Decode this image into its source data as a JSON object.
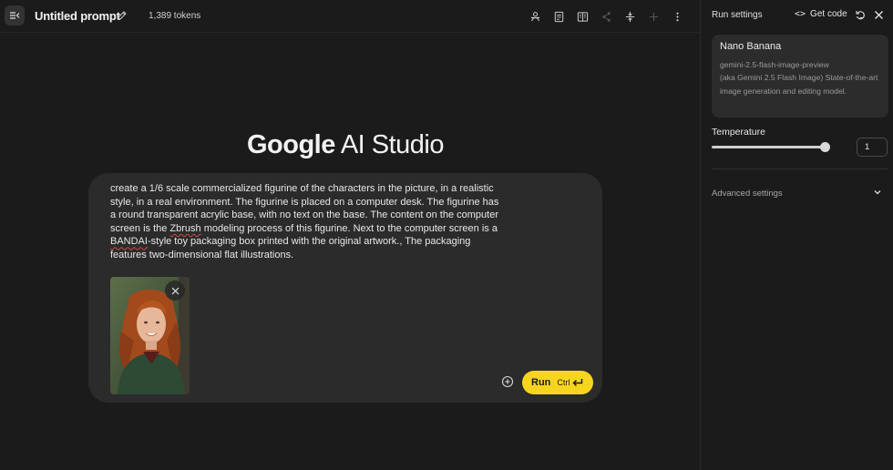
{
  "header": {
    "title": "Untitled prompt",
    "tokens": "1,389 tokens",
    "icons": [
      "menu-collapse-icon",
      "edit-icon",
      "compare-icon",
      "document-icon",
      "book-icon",
      "share-icon",
      "compress-icon",
      "add-icon",
      "more-vert-icon"
    ]
  },
  "main": {
    "brand_google": "Google",
    "brand_studio": " AI Studio",
    "prompt_part1": "create a 1/6 scale commercialized figurine of the characters in the picture, in a realistic style, in a real environment. The figurine is placed on a computer desk. The figurine has a round transparent acrylic base, with no text on the base. The content on the computer screen is the ",
    "prompt_zbrush": "Zbrush",
    "prompt_part2": " modeling process of this figurine. Next to the computer screen is a ",
    "prompt_bandai": "BANDAI",
    "prompt_part3": "-style toy packaging box printed with the original artwork., The packaging features two-dimensional flat illustrations.",
    "run_label": "Run",
    "run_shortcut": "Ctrl"
  },
  "sidebar": {
    "title": "Run settings",
    "get_code": "Get code",
    "model_name": "Nano Banana",
    "model_desc_id": "gemini-2.5-flash-image-preview",
    "model_desc": "(aka Gemini 2.5 Flash Image) State-of-the-art image generation and editing model.",
    "temperature_label": "Temperature",
    "temperature_value": "1",
    "temperature_level": 1.0,
    "advanced_label": "Advanced settings"
  },
  "colors": {
    "background": "#1b1b1b",
    "card": "#2b2b2b",
    "run_accent": "#f7d51e",
    "spellcheck": "#d24a4a"
  }
}
